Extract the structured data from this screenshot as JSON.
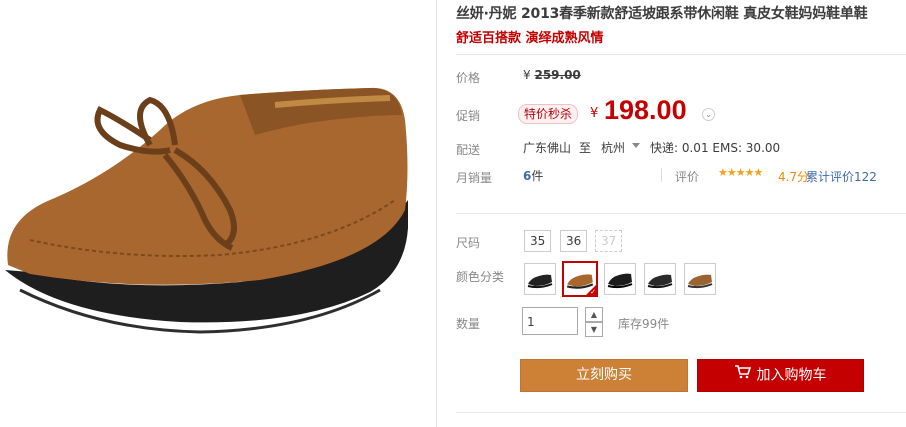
{
  "product": {
    "title": "丝妍·丹妮 2013春季新款舒适坡跟系带休闲鞋 真皮女鞋妈妈鞋单鞋",
    "subtitle": "舒适百搭款 演绎成熟风情",
    "image_alt": "brown-leather-lace-up-wedge-shoe"
  },
  "pricing": {
    "orig_label": "价格",
    "orig_currency": "¥",
    "orig_value": "259.00",
    "promo_label": "促销",
    "promo_badge": "特价秒杀",
    "promo_currency": "¥",
    "promo_value": "198.00"
  },
  "shipping": {
    "label": "配送",
    "from": "广东佛山",
    "to_word": "至",
    "destination": "杭州",
    "rates": "快递: 0.01 EMS: 30.00"
  },
  "sales": {
    "label": "月销量",
    "count": "6",
    "unit": "件",
    "review_label": "评价",
    "stars": "★★★★★",
    "rating": "4.7分",
    "reviews": "累计评价122"
  },
  "options": {
    "size_label": "尺码",
    "sizes": [
      "35",
      "36",
      "37"
    ],
    "color_label": "颜色分类",
    "quantity_label": "数量",
    "quantity_value": "1",
    "stock": "库存99件"
  },
  "actions": {
    "buy_now": "立刻购买",
    "add_to_cart": "加入购物车"
  },
  "colors": {
    "accent": "#c40000",
    "buy_button": "#cd8137",
    "link": "#3c6bb0",
    "stars": "#f5a21b"
  }
}
